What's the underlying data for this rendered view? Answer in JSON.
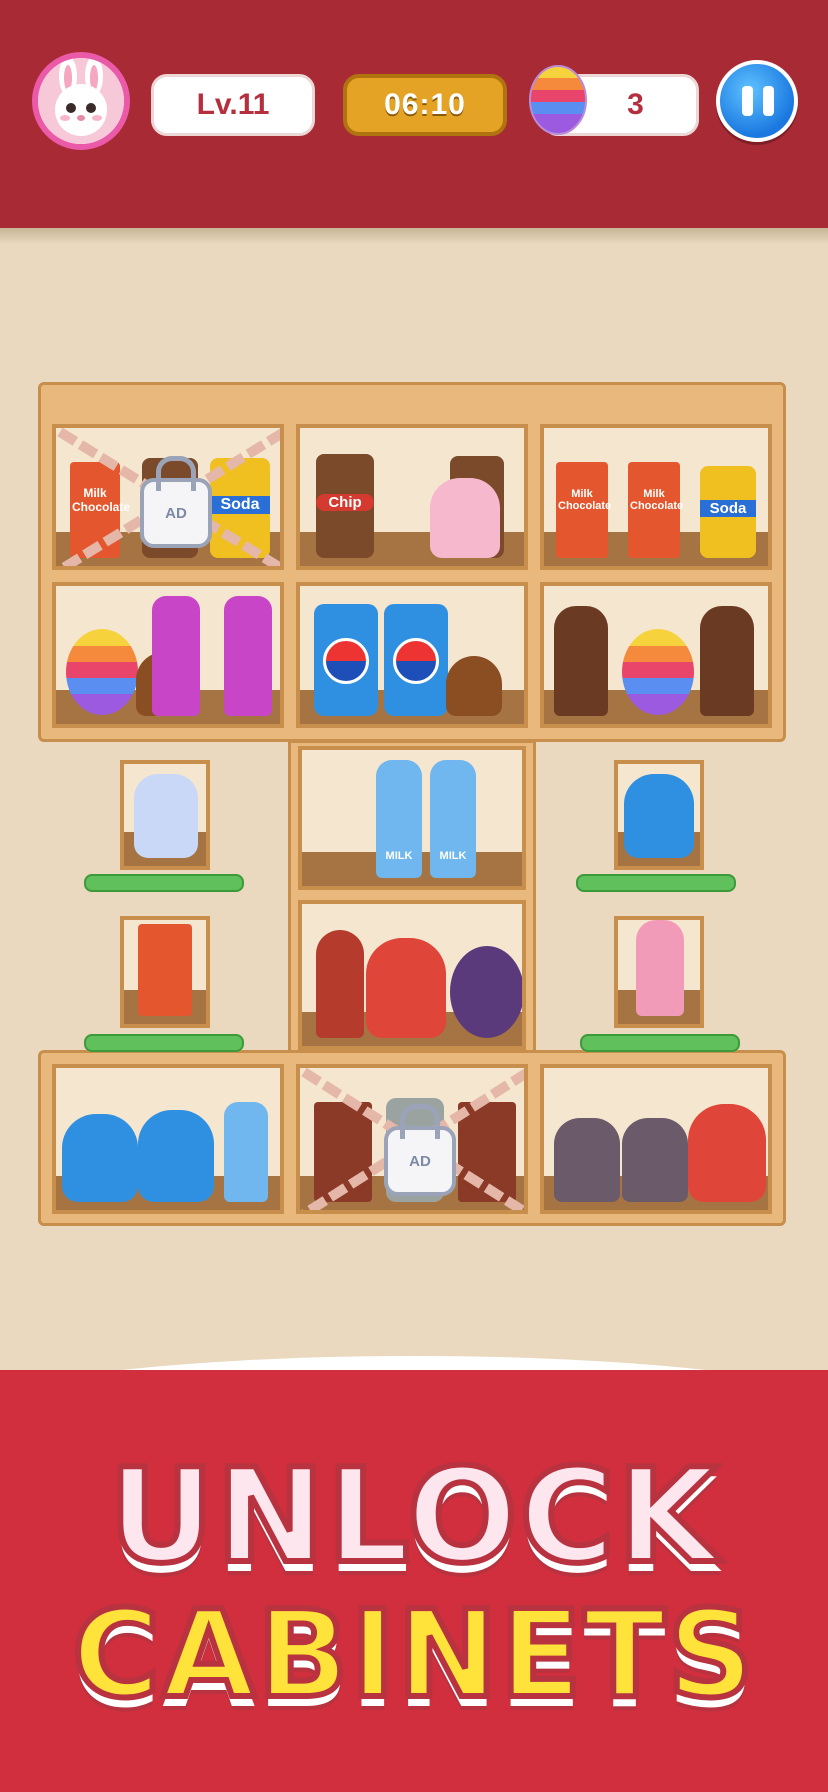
{
  "hud": {
    "level": "Lv.11",
    "timer": "06:10",
    "egg_count": "3",
    "avatar_icon": "bunny-avatar",
    "pause_icon": "pause-icon"
  },
  "cabinets": {
    "locked_label": "AD",
    "products": {
      "milk_chocolate": [
        "Milk",
        "Chocolate"
      ],
      "soda": "Soda",
      "chip": "Chip",
      "milk": "MILK"
    }
  },
  "banner": {
    "line1": "UNLOCK",
    "line2": "CABINETS"
  },
  "colors": {
    "header_red": "#a82a35",
    "banner_red": "#d12f3d",
    "timer_gold": "#e5a325",
    "pause_blue": "#1a78e0",
    "wood": "#e8b87c",
    "headline_yellow": "#ffe23a"
  }
}
